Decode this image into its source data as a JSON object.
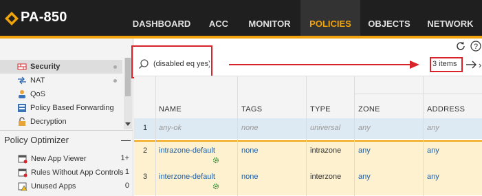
{
  "app": {
    "brand": "PA-850"
  },
  "nav": {
    "tabs": [
      {
        "label": "DASHBOARD",
        "active": false
      },
      {
        "label": "ACC",
        "active": false
      },
      {
        "label": "MONITOR",
        "active": false
      },
      {
        "label": "POLICIES",
        "active": true
      },
      {
        "label": "OBJECTS",
        "active": false
      },
      {
        "label": "NETWORK",
        "active": false
      }
    ]
  },
  "toolbar": {
    "icons": [
      "refresh-icon",
      "help-icon"
    ]
  },
  "sidebar": {
    "items": [
      {
        "label": "Security",
        "icon": "security-rules-icon",
        "selected": true,
        "dot": true
      },
      {
        "label": "NAT",
        "icon": "nat-icon",
        "selected": false,
        "dot": true
      },
      {
        "label": "QoS",
        "icon": "qos-icon",
        "selected": false,
        "dot": false
      },
      {
        "label": "Policy Based Forwarding",
        "icon": "pbf-icon",
        "selected": false,
        "dot": false
      },
      {
        "label": "Decryption",
        "icon": "decryption-icon",
        "selected": false,
        "dot": false
      }
    ]
  },
  "optimizer": {
    "title": "Policy Optimizer",
    "collapse_label": "—",
    "items": [
      {
        "label": "New App Viewer",
        "count": "1+",
        "icon": "new-app-viewer-icon"
      },
      {
        "label": "Rules Without App Controls",
        "count": "1",
        "icon": "rules-without-app-icon"
      },
      {
        "label": "Unused Apps",
        "count": "0",
        "icon": "unused-apps-icon"
      }
    ]
  },
  "filter": {
    "value": "(disabled eq yes)",
    "placeholder": "",
    "items_count": "3 items"
  },
  "colors": {
    "accent": "#f0a30a",
    "topbar": "#1f1f1f",
    "annotation": "#d8232a",
    "link": "#1f5fa6",
    "disabled_row": "#dde9f3",
    "highlight_row": "#fdf1d0"
  },
  "table": {
    "columns": [
      "NAME",
      "TAGS",
      "TYPE",
      "ZONE",
      "ADDRESS"
    ],
    "rows": [
      {
        "num": "1",
        "name": "any-ok",
        "tags": "none",
        "type": "universal",
        "zone": "any",
        "address": "any",
        "disabled": true
      },
      {
        "num": "2",
        "name": "intrazone-default",
        "tags": "none",
        "type": "intrazone",
        "zone": "any",
        "address": "any",
        "disabled": false
      },
      {
        "num": "3",
        "name": "interzone-default",
        "tags": "none",
        "type": "interzone",
        "zone": "any",
        "address": "any",
        "disabled": false
      }
    ]
  }
}
